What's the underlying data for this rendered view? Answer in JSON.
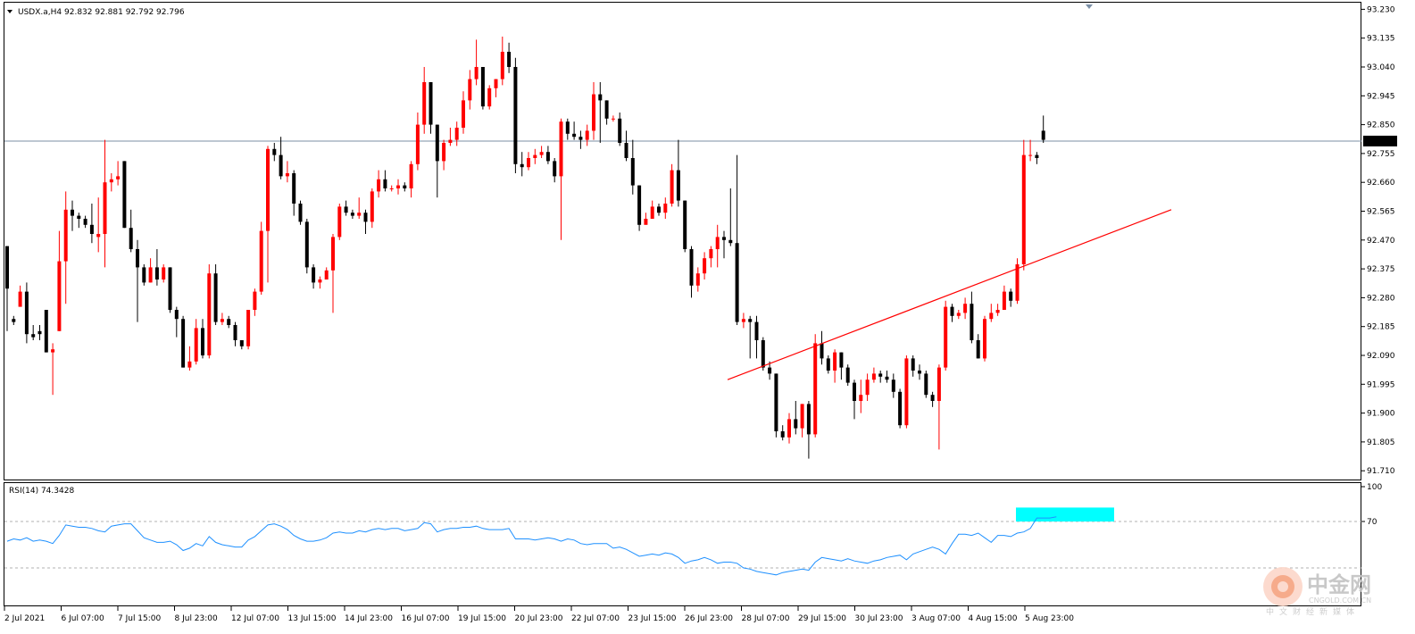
{
  "header": {
    "symbol_label": "USDX.a,H4",
    "ohlc_label": "92.832 92.881 92.792 92.796",
    "rsi_label": "RSI(14) 74.3428"
  },
  "price_axis": {
    "ticks": [
      "93.230",
      "93.135",
      "93.040",
      "92.945",
      "92.850",
      "92.755",
      "92.660",
      "92.565",
      "92.470",
      "92.375",
      "92.280",
      "92.185",
      "92.090",
      "91.995",
      "91.900",
      "91.805",
      "91.710"
    ],
    "current_price": "92.796"
  },
  "rsi_axis": {
    "ticks": [
      "100",
      "70"
    ]
  },
  "time_axis": {
    "labels": [
      "2 Jul 2021",
      "6 Jul 07:00",
      "7 Jul 15:00",
      "8 Jul 23:00",
      "12 Jul 07:00",
      "13 Jul 15:00",
      "14 Jul 23:00",
      "16 Jul 07:00",
      "19 Jul 15:00",
      "20 Jul 23:00",
      "22 Jul 07:00",
      "23 Jul 15:00",
      "26 Jul 23:00",
      "28 Jul 07:00",
      "29 Jul 15:00",
      "30 Jul 23:00",
      "3 Aug 07:00",
      "4 Aug 15:00",
      "5 Aug 23:00"
    ]
  },
  "watermark": {
    "cn": "中金网",
    "en": "CNGOLD.COM.CN",
    "sub": "中文财经新媒体"
  },
  "colors": {
    "bull": "#ff0000",
    "bear": "#000000",
    "trendline": "#ff0000",
    "rsi_line": "#1e90ff",
    "highlight": "#00ffff",
    "current_line": "#7b8fa6"
  },
  "chart_data": {
    "type": "candlestick",
    "symbol": "USDX.a",
    "timeframe": "H4",
    "ylim": [
      91.69,
      93.24
    ],
    "candles": [
      [
        92.45,
        92.31,
        92.37,
        92.17
      ],
      [
        92.21,
        92.2,
        92.22,
        92.19
      ],
      [
        92.25,
        92.3,
        92.32,
        92.26
      ],
      [
        92.3,
        92.16,
        92.33,
        92.13
      ],
      [
        92.16,
        92.15,
        92.19,
        92.14
      ],
      [
        92.17,
        92.16,
        92.19,
        92.14
      ],
      [
        92.24,
        92.1,
        92.24,
        92.1
      ],
      [
        92.1,
        92.11,
        92.13,
        91.96
      ],
      [
        92.17,
        92.4,
        92.5,
        92.17
      ],
      [
        92.4,
        92.57,
        92.63,
        92.26
      ],
      [
        92.57,
        92.55,
        92.6,
        92.5
      ],
      [
        92.55,
        92.54,
        92.56,
        92.51
      ],
      [
        92.54,
        92.52,
        92.55,
        92.51
      ],
      [
        92.52,
        92.49,
        92.59,
        92.46
      ],
      [
        92.48,
        92.49,
        92.61,
        92.43
      ],
      [
        92.49,
        92.66,
        92.8,
        92.38
      ],
      [
        92.66,
        92.67,
        92.69,
        92.63
      ],
      [
        92.67,
        92.68,
        92.73,
        92.65
      ],
      [
        92.73,
        92.51,
        92.73,
        92.51
      ],
      [
        92.51,
        92.44,
        92.57,
        92.43
      ],
      [
        92.44,
        92.38,
        92.47,
        92.2
      ],
      [
        92.38,
        92.33,
        92.39,
        92.32
      ],
      [
        92.33,
        92.38,
        92.41,
        92.33
      ],
      [
        92.38,
        92.34,
        92.44,
        92.32
      ],
      [
        92.34,
        92.38,
        92.39,
        92.33
      ],
      [
        92.38,
        92.24,
        92.38,
        92.23
      ],
      [
        92.24,
        92.21,
        92.25,
        92.15
      ],
      [
        92.21,
        92.05,
        92.22,
        92.05
      ],
      [
        92.05,
        92.07,
        92.12,
        92.04
      ],
      [
        92.07,
        92.18,
        92.21,
        92.06
      ],
      [
        92.18,
        92.09,
        92.21,
        92.08
      ],
      [
        92.09,
        92.36,
        92.39,
        92.08
      ],
      [
        92.36,
        92.2,
        92.39,
        92.19
      ],
      [
        92.2,
        92.21,
        92.23,
        92.19
      ],
      [
        92.21,
        92.19,
        92.22,
        92.18
      ],
      [
        92.19,
        92.14,
        92.2,
        92.12
      ],
      [
        92.14,
        92.12,
        92.14,
        92.11
      ],
      [
        92.12,
        92.24,
        92.24,
        92.11
      ],
      [
        92.24,
        92.3,
        92.31,
        92.22
      ],
      [
        92.3,
        92.5,
        92.53,
        92.29
      ],
      [
        92.5,
        92.77,
        92.78,
        92.33
      ],
      [
        92.77,
        92.75,
        92.79,
        92.73
      ],
      [
        92.75,
        92.68,
        92.81,
        92.67
      ],
      [
        92.68,
        92.69,
        92.73,
        92.66
      ],
      [
        92.69,
        92.59,
        92.7,
        92.55
      ],
      [
        92.59,
        92.53,
        92.6,
        92.52
      ],
      [
        92.53,
        92.38,
        92.54,
        92.36
      ],
      [
        92.38,
        92.33,
        92.39,
        92.31
      ],
      [
        92.33,
        92.34,
        92.35,
        92.31
      ],
      [
        92.34,
        92.37,
        92.38,
        92.35
      ],
      [
        92.37,
        92.48,
        92.49,
        92.23
      ],
      [
        92.48,
        92.58,
        92.59,
        92.47
      ],
      [
        92.58,
        92.56,
        92.6,
        92.55
      ],
      [
        92.56,
        92.55,
        92.57,
        92.54
      ],
      [
        92.55,
        92.56,
        92.61,
        92.54
      ],
      [
        92.56,
        92.53,
        92.57,
        92.49
      ],
      [
        92.53,
        92.63,
        92.64,
        92.51
      ],
      [
        92.63,
        92.67,
        92.7,
        92.61
      ],
      [
        92.67,
        92.64,
        92.7,
        92.63
      ],
      [
        92.64,
        92.64,
        92.65,
        92.63
      ],
      [
        92.64,
        92.65,
        92.67,
        92.62
      ],
      [
        92.65,
        92.64,
        92.66,
        92.63
      ],
      [
        92.64,
        92.72,
        92.73,
        92.61
      ],
      [
        92.72,
        92.85,
        92.89,
        92.7
      ],
      [
        92.85,
        92.99,
        93.04,
        92.82
      ],
      [
        92.99,
        92.85,
        92.99,
        92.82
      ],
      [
        92.85,
        92.73,
        92.85,
        92.61
      ],
      [
        92.73,
        92.79,
        92.8,
        92.7
      ],
      [
        92.79,
        92.8,
        92.84,
        92.78
      ],
      [
        92.8,
        92.84,
        92.86,
        92.78
      ],
      [
        92.84,
        92.93,
        92.96,
        92.82
      ],
      [
        92.93,
        93.0,
        93.03,
        92.9
      ],
      [
        93.0,
        93.04,
        93.13,
        92.98
      ],
      [
        93.04,
        92.91,
        93.04,
        92.9
      ],
      [
        92.91,
        92.97,
        92.98,
        92.9
      ],
      [
        92.97,
        93.0,
        93.0,
        92.94
      ],
      [
        93.0,
        93.09,
        93.14,
        92.98
      ],
      [
        93.09,
        93.04,
        93.12,
        93.02
      ],
      [
        93.04,
        92.72,
        93.07,
        92.69
      ],
      [
        92.72,
        92.71,
        92.76,
        92.68
      ],
      [
        92.71,
        92.74,
        92.76,
        92.7
      ],
      [
        92.74,
        92.75,
        92.77,
        92.72
      ],
      [
        92.75,
        92.76,
        92.78,
        92.74
      ],
      [
        92.76,
        92.73,
        92.78,
        92.72
      ],
      [
        92.73,
        92.68,
        92.74,
        92.66
      ],
      [
        92.68,
        92.86,
        92.87,
        92.47
      ],
      [
        92.86,
        92.82,
        92.87,
        92.8
      ],
      [
        92.82,
        92.81,
        92.86,
        92.8
      ],
      [
        92.81,
        92.8,
        92.83,
        92.77
      ],
      [
        92.8,
        92.83,
        92.85,
        92.78
      ],
      [
        92.83,
        92.95,
        92.99,
        92.8
      ],
      [
        92.95,
        92.93,
        92.99,
        92.79
      ],
      [
        92.93,
        92.87,
        92.93,
        92.85
      ],
      [
        92.87,
        92.87,
        92.88,
        92.86
      ],
      [
        92.87,
        92.79,
        92.89,
        92.78
      ],
      [
        92.79,
        92.74,
        92.83,
        92.73
      ],
      [
        92.74,
        92.65,
        92.8,
        92.62
      ],
      [
        92.65,
        92.52,
        92.65,
        92.5
      ],
      [
        92.52,
        92.54,
        92.56,
        92.53
      ],
      [
        92.54,
        92.58,
        92.6,
        92.55
      ],
      [
        92.58,
        92.56,
        92.59,
        92.55
      ],
      [
        92.56,
        92.59,
        92.61,
        92.54
      ],
      [
        92.59,
        92.7,
        92.72,
        92.58
      ],
      [
        92.7,
        92.6,
        92.8,
        92.58
      ],
      [
        92.6,
        92.44,
        92.6,
        92.43
      ],
      [
        92.44,
        92.32,
        92.45,
        92.28
      ],
      [
        92.32,
        92.36,
        92.38,
        92.3
      ],
      [
        92.36,
        92.41,
        92.43,
        92.34
      ],
      [
        92.41,
        92.44,
        92.45,
        92.38
      ],
      [
        92.44,
        92.48,
        92.52,
        92.38
      ],
      [
        92.48,
        92.47,
        92.5,
        92.41
      ],
      [
        92.47,
        92.46,
        92.64,
        92.45
      ],
      [
        92.46,
        92.2,
        92.75,
        92.19
      ],
      [
        92.2,
        92.21,
        92.23,
        92.18
      ],
      [
        92.21,
        92.2,
        92.22,
        92.08
      ],
      [
        92.2,
        92.14,
        92.22,
        92.08
      ],
      [
        92.14,
        92.05,
        92.15,
        92.04
      ],
      [
        92.05,
        92.03,
        92.07,
        92.01
      ],
      [
        92.03,
        91.84,
        92.03,
        91.82
      ],
      [
        91.84,
        91.82,
        91.86,
        91.81
      ],
      [
        91.82,
        91.88,
        91.9,
        91.8
      ],
      [
        91.88,
        91.85,
        91.94,
        91.83
      ],
      [
        91.85,
        91.93,
        91.93,
        91.82
      ],
      [
        91.93,
        91.83,
        91.94,
        91.75
      ],
      [
        91.83,
        92.13,
        92.16,
        91.82
      ],
      [
        92.13,
        92.08,
        92.17,
        92.06
      ],
      [
        92.08,
        92.04,
        92.09,
        92.03
      ],
      [
        92.04,
        92.1,
        92.11,
        92.0
      ],
      [
        92.1,
        92.05,
        92.1,
        92.01
      ],
      [
        92.05,
        92.0,
        92.06,
        91.99
      ],
      [
        92.0,
        91.94,
        92.01,
        91.88
      ],
      [
        91.94,
        91.96,
        92.01,
        91.9
      ],
      [
        91.96,
        92.01,
        92.03,
        91.94
      ],
      [
        92.01,
        92.03,
        92.05,
        92.0
      ],
      [
        92.03,
        92.02,
        92.04,
        92.0
      ],
      [
        92.02,
        92.01,
        92.04,
        92.0
      ],
      [
        92.01,
        91.97,
        92.03,
        91.95
      ],
      [
        91.97,
        91.86,
        91.98,
        91.85
      ],
      [
        91.86,
        92.08,
        92.09,
        91.85
      ],
      [
        92.08,
        92.04,
        92.09,
        92.02
      ],
      [
        92.04,
        92.03,
        92.06,
        92.01
      ],
      [
        92.03,
        91.96,
        92.04,
        91.95
      ],
      [
        91.96,
        91.94,
        91.97,
        91.92
      ],
      [
        91.94,
        92.05,
        92.06,
        91.78
      ],
      [
        92.05,
        92.25,
        92.27,
        92.04
      ],
      [
        92.25,
        92.22,
        92.26,
        92.2
      ],
      [
        92.22,
        92.23,
        92.24,
        92.21
      ],
      [
        92.23,
        92.26,
        92.28,
        92.21
      ],
      [
        92.26,
        92.14,
        92.3,
        92.13
      ],
      [
        92.14,
        92.08,
        92.16,
        92.08
      ],
      [
        92.08,
        92.21,
        92.22,
        92.07
      ],
      [
        92.21,
        92.23,
        92.26,
        92.2
      ],
      [
        92.23,
        92.24,
        92.26,
        92.22
      ],
      [
        92.24,
        92.3,
        92.32,
        92.24
      ],
      [
        92.3,
        92.27,
        92.31,
        92.25
      ],
      [
        92.27,
        92.39,
        92.41,
        92.26
      ],
      [
        92.39,
        92.75,
        92.8,
        92.37
      ],
      [
        92.75,
        92.75,
        92.8,
        92.73
      ],
      [
        92.75,
        92.74,
        92.76,
        92.72
      ],
      [
        92.83,
        92.8,
        92.88,
        92.79
      ]
    ],
    "current_price": 92.796,
    "trendline": {
      "points": [
        [
          0,
          92.01
        ],
        [
          250,
          92.57
        ]
      ]
    },
    "rsi": {
      "period": 14,
      "value": 74.3428,
      "ylim": [
        0,
        100
      ],
      "levels": [
        70,
        30
      ],
      "values": [
        53,
        55,
        54,
        56,
        53,
        54,
        53,
        51,
        58,
        67,
        66,
        65,
        65,
        64,
        62,
        61,
        66,
        67,
        68,
        68,
        62,
        56,
        54,
        52,
        52,
        53,
        50,
        45,
        47,
        51,
        49,
        57,
        52,
        50,
        49,
        48,
        48,
        54,
        57,
        62,
        67,
        68,
        66,
        63,
        58,
        55,
        53,
        53,
        54,
        56,
        60,
        61,
        60,
        60,
        62,
        61,
        63,
        64,
        63,
        64,
        64,
        62,
        63,
        64,
        69,
        68,
        61,
        63,
        64,
        64,
        65,
        65,
        66,
        64,
        63,
        63,
        63,
        64,
        55,
        55,
        55,
        54,
        55,
        56,
        55,
        53,
        55,
        54,
        51,
        50,
        51,
        51,
        51,
        47,
        48,
        46,
        43,
        40,
        41,
        42,
        41,
        43,
        42,
        39,
        34,
        36,
        37,
        39,
        37,
        34,
        35,
        35,
        34,
        30,
        29,
        27,
        26,
        25,
        24,
        26,
        27,
        28,
        29,
        28,
        35,
        39,
        38,
        37,
        36,
        38,
        36,
        35,
        34,
        36,
        37,
        39,
        40,
        41,
        37,
        42,
        44,
        46,
        48,
        46,
        42,
        51,
        59,
        59,
        58,
        60,
        56,
        52,
        58,
        58,
        57,
        60,
        61,
        64,
        73,
        73,
        73,
        74
      ]
    },
    "highlight_rsi_zone": [
      70,
      82
    ]
  }
}
